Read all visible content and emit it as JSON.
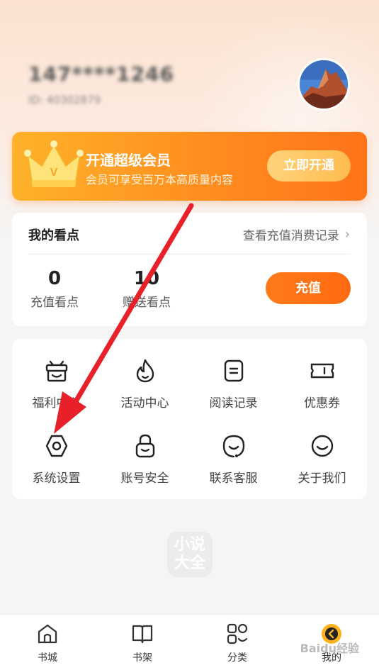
{
  "header": {
    "user_name": "147****1246",
    "user_id": "ID: 40302879"
  },
  "vip": {
    "title": "开通超级会员",
    "subtitle": "会员可享受百万本高质量内容",
    "button": "立即开通"
  },
  "points": {
    "title": "我的看点",
    "link": "查看充值消费记录",
    "stats": [
      {
        "value": "0",
        "label": "充值看点"
      },
      {
        "value": "10",
        "label": "赠送看点"
      }
    ],
    "recharge": "充值"
  },
  "menu": {
    "items": [
      {
        "label": "福利中心",
        "icon": "gift-bag-icon"
      },
      {
        "label": "活动中心",
        "icon": "flame-icon"
      },
      {
        "label": "阅读记录",
        "icon": "reading-record-icon"
      },
      {
        "label": "优惠券",
        "icon": "coupon-icon"
      },
      {
        "label": "系统设置",
        "icon": "settings-icon"
      },
      {
        "label": "账号安全",
        "icon": "lock-icon"
      },
      {
        "label": "联系客服",
        "icon": "customer-service-icon"
      },
      {
        "label": "关于我们",
        "icon": "about-icon"
      }
    ]
  },
  "brand": {
    "logo_text_1": "小说",
    "logo_text_2": "大全"
  },
  "tabbar": {
    "tabs": [
      {
        "label": "书城",
        "icon": "home-icon"
      },
      {
        "label": "书架",
        "icon": "bookshelf-icon"
      },
      {
        "label": "分类",
        "icon": "category-icon"
      },
      {
        "label": "我的",
        "icon": "profile-icon"
      }
    ]
  },
  "watermark": "Baidu经验",
  "colors": {
    "accent": "#ff7419",
    "vip_gradient_start": "#ffb22a",
    "annotation_arrow": "#e8202a"
  }
}
